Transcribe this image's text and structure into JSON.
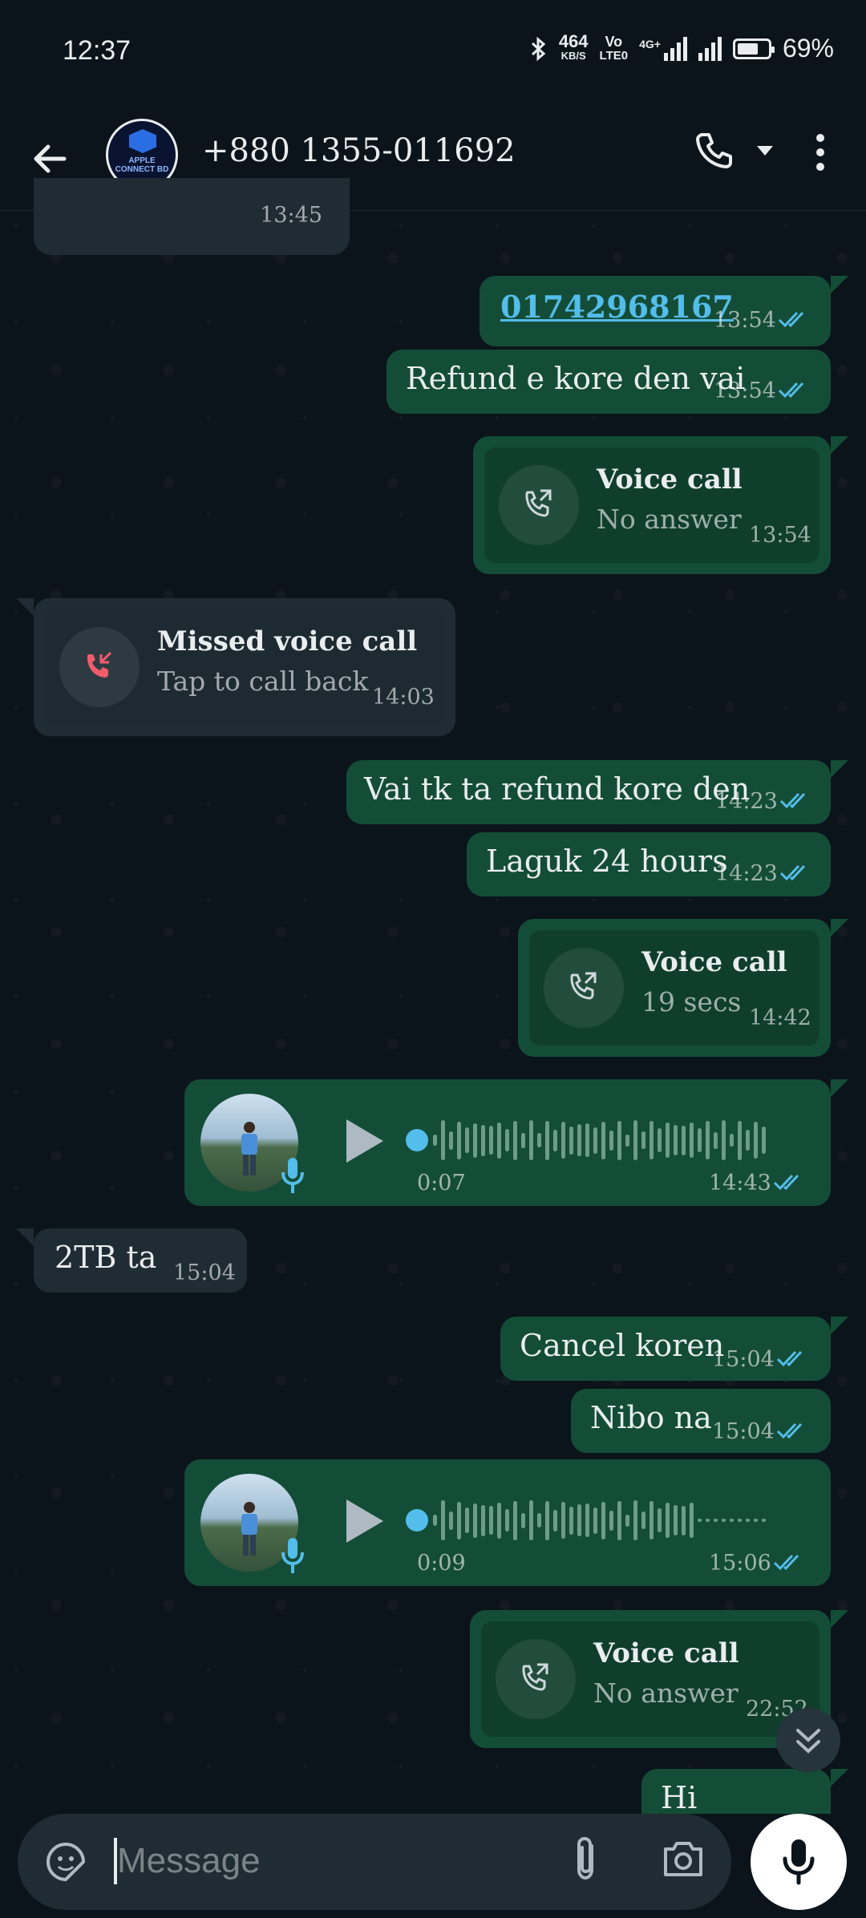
{
  "status_bar": {
    "time": "12:37",
    "net_speed_value": "464",
    "net_speed_unit": "KB/S",
    "volte_top": "Vo",
    "volte_bottom": "LTE0",
    "net_type": "4G+",
    "battery": "69%"
  },
  "header": {
    "contact_name": "+880 1355-011692",
    "avatar_text": "APPLE CONNECT BD"
  },
  "messages": [
    {
      "dir": "in",
      "type": "partial",
      "time": "13:45"
    },
    {
      "dir": "out",
      "type": "link",
      "text": "01742968167",
      "time": "13:54",
      "read": true
    },
    {
      "dir": "out",
      "type": "text",
      "text": "Refund e kore den vai",
      "time": "13:54",
      "read": true
    },
    {
      "dir": "out",
      "type": "call",
      "title": "Voice call",
      "sub": "No answer",
      "time": "13:54"
    },
    {
      "dir": "in",
      "type": "call",
      "title": "Missed voice call",
      "sub": "Tap to call back",
      "time": "14:03"
    },
    {
      "dir": "out",
      "type": "text",
      "text": "Vai tk ta refund kore den",
      "time": "14:23",
      "read": true
    },
    {
      "dir": "out",
      "type": "text",
      "text": "Laguk 24 hours",
      "time": "14:23",
      "read": true
    },
    {
      "dir": "out",
      "type": "call",
      "title": "Voice call",
      "sub": "19 secs",
      "time": "14:42"
    },
    {
      "dir": "out",
      "type": "voice",
      "duration": "0:07",
      "time": "14:43",
      "read": true
    },
    {
      "dir": "in",
      "type": "text",
      "text": "2TB ta",
      "time": "15:04"
    },
    {
      "dir": "out",
      "type": "text",
      "text": "Cancel koren",
      "time": "15:04",
      "read": true
    },
    {
      "dir": "out",
      "type": "text",
      "text": "Nibo na",
      "time": "15:04",
      "read": true
    },
    {
      "dir": "out",
      "type": "voice",
      "duration": "0:09",
      "time": "15:06",
      "read": true
    },
    {
      "dir": "out",
      "type": "call",
      "title": "Voice call",
      "sub": "No answer",
      "time": "22:52"
    },
    {
      "dir": "out",
      "type": "text",
      "text": "Hi",
      "time": ""
    }
  ],
  "composer": {
    "placeholder": "Message"
  },
  "colors": {
    "background": "#0b141a",
    "outgoing_bubble": "#144d37",
    "incoming_bubble": "#202c33",
    "read_ticks": "#53bdeb",
    "missed_call": "#f15c6d"
  },
  "icons": {
    "back": "arrow-left-icon",
    "call": "phone-icon",
    "dropdown": "chevron-down-icon",
    "menu": "more-vertical-icon",
    "emoji": "sticker-icon",
    "attach": "paperclip-icon",
    "camera": "camera-icon",
    "mic": "mic-icon",
    "scroll_down": "double-chevron-down-icon"
  }
}
